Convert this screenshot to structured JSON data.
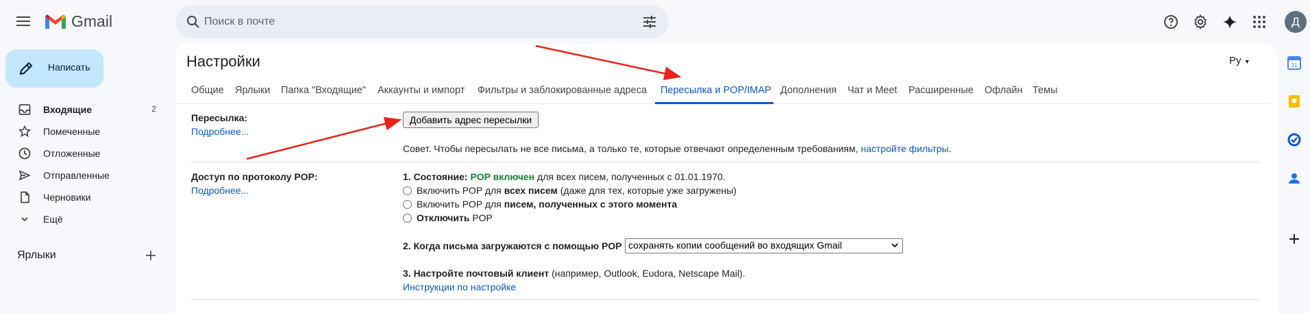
{
  "header": {
    "app_name": "Gmail",
    "search_placeholder": "Поиск в почте",
    "avatar_letter": "Д",
    "icons": [
      "menu-icon",
      "gmail-logo-icon",
      "search-icon",
      "tune-icon",
      "help-icon",
      "gear-icon",
      "gemini-icon",
      "apps-icon"
    ]
  },
  "sidebar": {
    "compose_label": "Написать",
    "items": [
      {
        "label": "Входящие",
        "count": "2",
        "icon": "inbox-icon"
      },
      {
        "label": "Помеченные",
        "count": "",
        "icon": "star-icon"
      },
      {
        "label": "Отложенные",
        "count": "",
        "icon": "clock-icon"
      },
      {
        "label": "Отправленные",
        "count": "",
        "icon": "send-icon"
      },
      {
        "label": "Черновики",
        "count": "",
        "icon": "draft-icon"
      },
      {
        "label": "Ещё",
        "count": "",
        "icon": "chevron-down-icon"
      }
    ],
    "labels_heading": "Ярлыки"
  },
  "settings": {
    "title": "Настройки",
    "language": "Ру",
    "tabs": [
      {
        "label": "Общие",
        "active": false
      },
      {
        "label": "Ярлыки",
        "active": false
      },
      {
        "label": "Папка \"Входящие\"",
        "active": false
      },
      {
        "label": "Аккаунты и импорт",
        "active": false
      },
      {
        "label": "Фильтры и заблокированные адреса",
        "active": false
      },
      {
        "label": "Пересылка и POP/IMAP",
        "active": true
      },
      {
        "label": "Дополнения",
        "active": false
      },
      {
        "label": "Чат и Meet",
        "active": false
      },
      {
        "label": "Расширенные",
        "active": false
      },
      {
        "label": "Офлайн",
        "active": false
      },
      {
        "label": "Темы",
        "active": false
      }
    ],
    "forwarding": {
      "label": "Пересылка:",
      "more_link": "Подробнее...",
      "add_button": "Добавить адрес пересылки",
      "tip": "Совет. Чтобы пересылать не все письма, а только те, которые отвечают определенным требованиям,",
      "tip_link": "настройте фильтры",
      "tip_end": "."
    },
    "pop": {
      "label": "Доступ по протоколу POP:",
      "more_link": "Подробнее...",
      "status_prefix": "1. Состояние:",
      "status_value": "POP включен",
      "status_suffix": "для всех писем, полученных с 01.01.1970.",
      "opt1_a": "Включить POP для",
      "opt1_b": "всех писем",
      "opt1_c": "(даже для тех, которые уже загружены)",
      "opt2_a": "Включить POP для",
      "opt2_b": "писем, полученных с этого момента",
      "opt3_a": "Отключить",
      "opt3_b": "POP",
      "when_label": "2. Когда письма загружаются с помощью POP",
      "when_value": "сохранять копии сообщений во входящих Gmail",
      "client_label": "3. Настройте почтовый клиент",
      "client_suffix": "(например, Outlook, Eudora, Netscape Mail).",
      "instructions_link": "Инструкции по настройке"
    }
  },
  "rail": {
    "icons": [
      "calendar-icon",
      "keep-icon",
      "tasks-icon",
      "contacts-icon",
      "add-icon"
    ],
    "calendar_day": "31"
  },
  "colors": {
    "accent": "#0b57d0",
    "compose_bg": "#c2e7ff",
    "pop_on": "#188038",
    "arrow": "#e8231a"
  }
}
